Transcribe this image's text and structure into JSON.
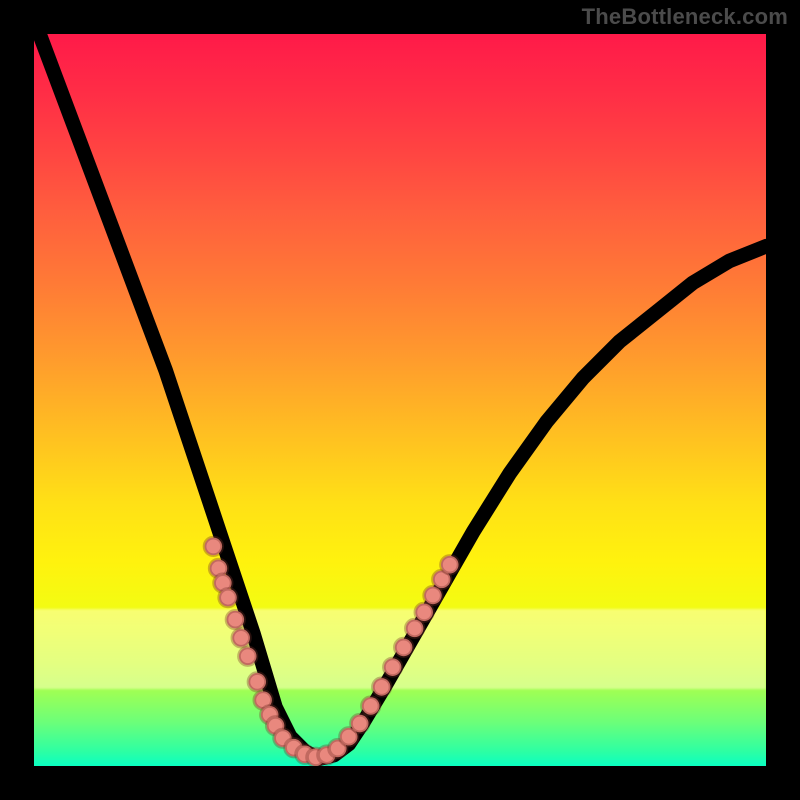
{
  "watermark": "TheBottleneck.com",
  "chart_data": {
    "type": "line",
    "title": "",
    "xlabel": "",
    "ylabel": "",
    "xlim": [
      0,
      100
    ],
    "ylim": [
      0,
      100
    ],
    "grid": false,
    "legend": false,
    "gradient_colors": {
      "top": "#ff1a49",
      "mid_upper": "#ff9a2d",
      "mid": "#ffe016",
      "mid_lower": "#ddff24",
      "bottom": "#0affc1"
    },
    "series": [
      {
        "name": "bottleneck-curve",
        "x": [
          0,
          3,
          6,
          9,
          12,
          15,
          18,
          20,
          22,
          24,
          26,
          28,
          30,
          31.5,
          33,
          35,
          37,
          39,
          41,
          43,
          45,
          48,
          52,
          56,
          60,
          65,
          70,
          75,
          80,
          85,
          90,
          95,
          100
        ],
        "y": [
          102,
          94,
          86,
          78,
          70,
          62,
          54,
          48,
          42,
          36,
          30,
          24,
          18,
          13,
          8,
          4,
          2,
          1,
          1.5,
          3,
          6,
          11,
          18,
          25,
          32,
          40,
          47,
          53,
          58,
          62,
          66,
          69,
          71
        ]
      }
    ],
    "markers": {
      "name": "salmon-dots",
      "color": "#e9887e",
      "radius": 1.2,
      "points": [
        [
          24.5,
          30
        ],
        [
          25.2,
          27
        ],
        [
          25.8,
          25
        ],
        [
          26.5,
          23
        ],
        [
          27.5,
          20
        ],
        [
          28.3,
          17.5
        ],
        [
          29.2,
          15
        ],
        [
          30.5,
          11.5
        ],
        [
          31.3,
          9
        ],
        [
          32.2,
          7
        ],
        [
          33.0,
          5.5
        ],
        [
          34.0,
          3.8
        ],
        [
          35.5,
          2.5
        ],
        [
          37.0,
          1.6
        ],
        [
          38.5,
          1.2
        ],
        [
          40.0,
          1.5
        ],
        [
          41.5,
          2.4
        ],
        [
          43.0,
          4.0
        ],
        [
          44.5,
          5.8
        ],
        [
          46.0,
          8.2
        ],
        [
          47.5,
          10.8
        ],
        [
          49.0,
          13.5
        ],
        [
          50.5,
          16.2
        ],
        [
          52.0,
          18.8
        ],
        [
          53.3,
          21.0
        ],
        [
          54.5,
          23.3
        ],
        [
          55.7,
          25.5
        ],
        [
          56.8,
          27.5
        ]
      ]
    }
  }
}
